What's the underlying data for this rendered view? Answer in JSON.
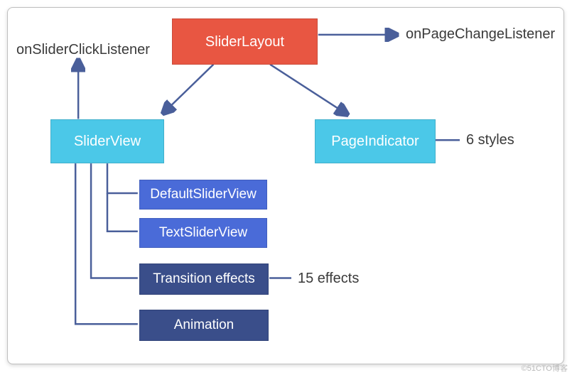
{
  "boxes": {
    "sliderLayout": "SliderLayout",
    "sliderView": "SliderView",
    "pageIndicator": "PageIndicator",
    "defaultSliderView": "DefaultSliderView",
    "textSliderView": "TextSliderView",
    "transitionEffects": "Transition effects",
    "animation": "Animation"
  },
  "labels": {
    "onSliderClickListener": "onSliderClickListener",
    "onPageChangeListener": "onPageChangeListener",
    "sixStyles": "6 styles",
    "fifteenEffects": "15 effects"
  },
  "watermark": "©51CTO博客",
  "chart_data": {
    "type": "diagram",
    "title": "SliderLayout component diagram",
    "nodes": [
      {
        "id": "SliderLayout",
        "type": "root",
        "color": "red"
      },
      {
        "id": "SliderView",
        "type": "component",
        "color": "cyan"
      },
      {
        "id": "PageIndicator",
        "type": "component",
        "color": "cyan",
        "note": "6 styles"
      },
      {
        "id": "DefaultSliderView",
        "type": "subclass",
        "color": "blue",
        "parent": "SliderView"
      },
      {
        "id": "TextSliderView",
        "type": "subclass",
        "color": "blue",
        "parent": "SliderView"
      },
      {
        "id": "Transition effects",
        "type": "feature",
        "color": "navy",
        "parent": "SliderView",
        "note": "15 effects"
      },
      {
        "id": "Animation",
        "type": "feature",
        "color": "navy",
        "parent": "SliderView"
      },
      {
        "id": "onSliderClickListener",
        "type": "listener",
        "parent": "SliderView"
      },
      {
        "id": "onPageChangeListener",
        "type": "listener",
        "parent": "SliderLayout"
      }
    ],
    "edges": [
      {
        "from": "SliderLayout",
        "to": "SliderView",
        "style": "arrow"
      },
      {
        "from": "SliderLayout",
        "to": "PageIndicator",
        "style": "arrow"
      },
      {
        "from": "SliderLayout",
        "to": "onPageChangeListener",
        "style": "arrow"
      },
      {
        "from": "SliderView",
        "to": "onSliderClickListener",
        "style": "arrow"
      },
      {
        "from": "SliderView",
        "to": "DefaultSliderView",
        "style": "tree"
      },
      {
        "from": "SliderView",
        "to": "TextSliderView",
        "style": "tree"
      },
      {
        "from": "SliderView",
        "to": "Transition effects",
        "style": "tree"
      },
      {
        "from": "SliderView",
        "to": "Animation",
        "style": "tree"
      },
      {
        "from": "PageIndicator",
        "to": "6 styles",
        "style": "line"
      },
      {
        "from": "Transition effects",
        "to": "15 effects",
        "style": "line"
      }
    ]
  }
}
